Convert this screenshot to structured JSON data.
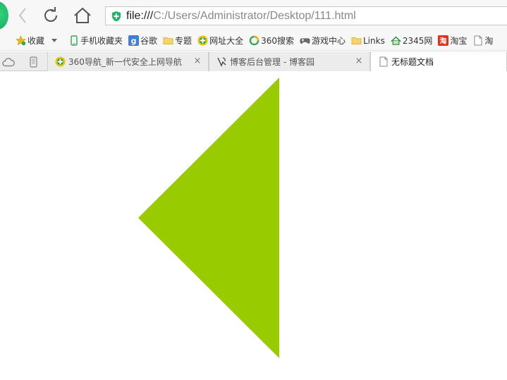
{
  "toolbar": {
    "url_scheme": "file:///",
    "url_path": "C:/Users/Administrator/Desktop/111.html"
  },
  "bookmarks": [
    {
      "label": "收藏",
      "icon": "star-icon"
    },
    {
      "label": "手机收藏夹",
      "icon": "phone-icon"
    },
    {
      "label": "谷歌",
      "icon": "google-icon"
    },
    {
      "label": "专题",
      "icon": "folder-icon"
    },
    {
      "label": "网址大全",
      "icon": "360-nav-icon"
    },
    {
      "label": "360搜索",
      "icon": "360-search-icon"
    },
    {
      "label": "游戏中心",
      "icon": "gamepad-icon"
    },
    {
      "label": "Links",
      "icon": "folder-icon"
    },
    {
      "label": "2345网",
      "icon": "2345-icon"
    },
    {
      "label": "淘宝",
      "icon": "taobao-icon"
    },
    {
      "label": "淘",
      "icon": "page-icon"
    }
  ],
  "tabs": [
    {
      "label": "360导航_新一代安全上网导航",
      "icon": "360-nav-icon",
      "close": "×"
    },
    {
      "label": "博客后台管理 - 博客园",
      "icon": "cnblogs-icon",
      "close": "×"
    },
    {
      "label": "无标题文档",
      "icon": "page-icon"
    }
  ],
  "colors": {
    "triangle": "#99cc00",
    "accent_green": "#1fb86a"
  }
}
